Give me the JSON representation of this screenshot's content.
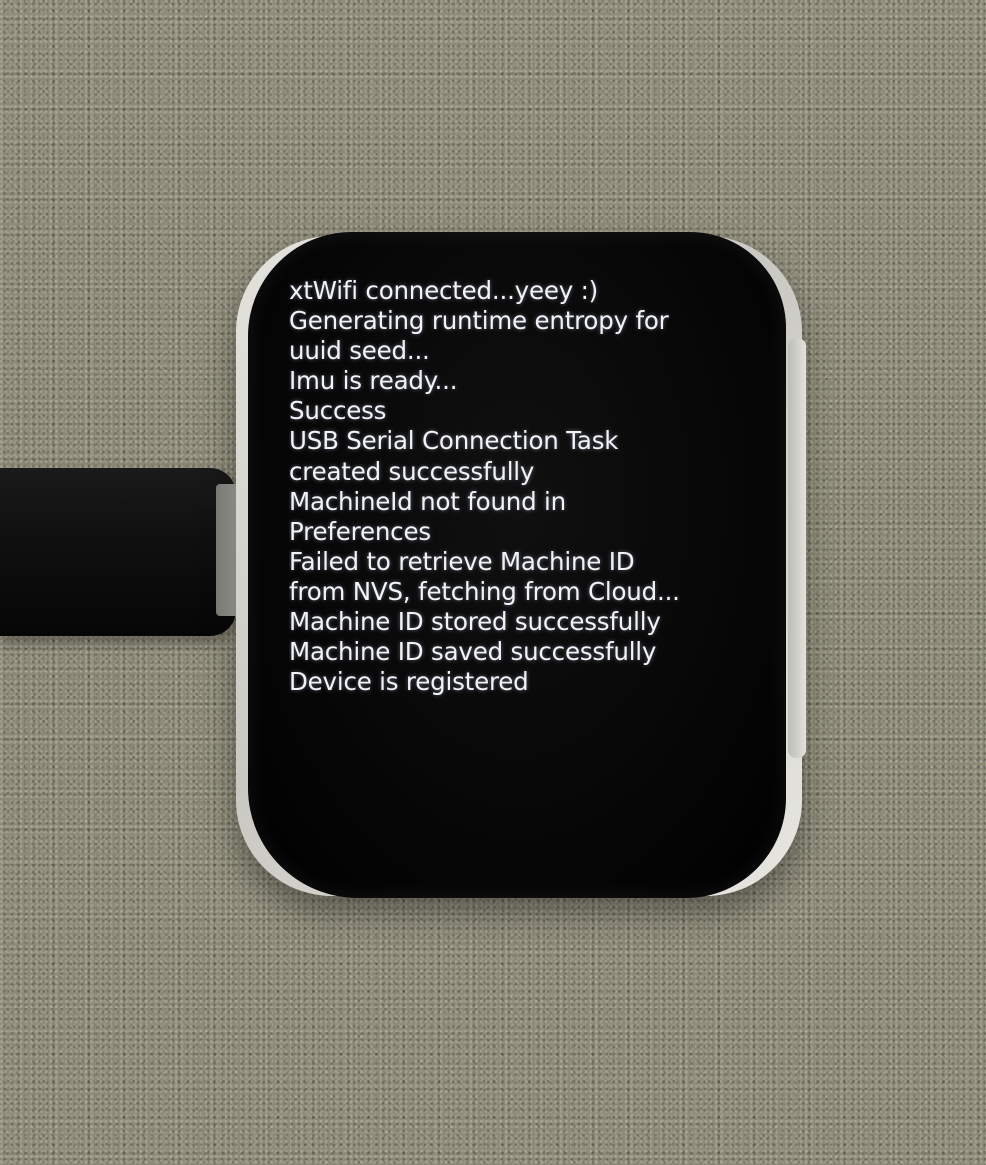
{
  "screen": {
    "lines": [
      "xtWifi connected...yeey :)",
      "Generating runtime entropy for",
      "uuid seed...",
      "Imu is ready...",
      "Success",
      "USB Serial Connection Task",
      "created successfully",
      "MachineId not found in",
      "Preferences",
      "Failed to retrieve Machine ID",
      "from NVS, fetching from Cloud...",
      "Machine ID stored successfully",
      "Machine ID saved successfully",
      "Device is registered"
    ]
  },
  "colors": {
    "screen_text": "#f2f3f7",
    "screen_background": "#050505",
    "case": "#d8d7d2",
    "backdrop": "#8c8a76",
    "cable": "#111111"
  }
}
